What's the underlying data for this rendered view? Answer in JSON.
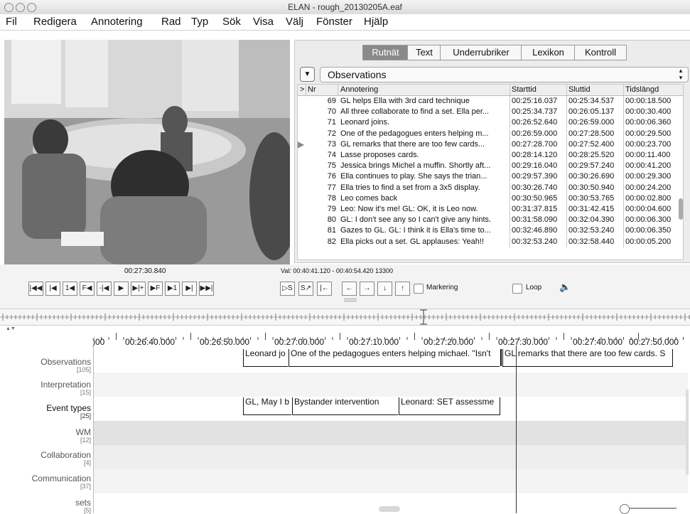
{
  "window": {
    "title": "ELAN - rough_20130205A.eaf"
  },
  "menu": [
    "Fil",
    "Redigera",
    "Annotering",
    "Rad",
    "Typ",
    "Sök",
    "Visa",
    "Välj",
    "Fönster",
    "Hjälp"
  ],
  "tabs": [
    {
      "label": "Rutnät",
      "selected": true
    },
    {
      "label": "Text",
      "selected": false
    },
    {
      "label": "Underrubriker",
      "selected": false
    },
    {
      "label": "Lexikon",
      "selected": false
    },
    {
      "label": "Kontroll",
      "selected": false
    }
  ],
  "grid": {
    "tier": "Observations",
    "dropdown_symbol": "▼",
    "spinner_symbol": "⌃⌄",
    "columns": {
      "marker": ">",
      "nr": "Nr",
      "annotation": "Annotering",
      "start": "Starttid",
      "end": "Sluttid",
      "duration": "Tidslängd"
    },
    "current_marker": "▶",
    "rows": [
      {
        "nr": "69",
        "text": "GL helps Ella with 3rd card technique",
        "start": "00:25:16.037",
        "end": "00:25:34.537",
        "dur": "00:00:18.500",
        "current": false
      },
      {
        "nr": "70",
        "text": "All three collaborate to find a set. Ella per...",
        "start": "00:25:34.737",
        "end": "00:26:05.137",
        "dur": "00:00:30.400",
        "current": false
      },
      {
        "nr": "71",
        "text": "Leonard joins.",
        "start": "00:26:52.640",
        "end": "00:26:59.000",
        "dur": "00:00:06.360",
        "current": false
      },
      {
        "nr": "72",
        "text": "One of the pedagogues enters helping m...",
        "start": "00:26:59.000",
        "end": "00:27:28.500",
        "dur": "00:00:29.500",
        "current": false
      },
      {
        "nr": "73",
        "text": "GL remarks that there are too few cards...",
        "start": "00:27:28.700",
        "end": "00:27:52.400",
        "dur": "00:00:23.700",
        "current": true
      },
      {
        "nr": "74",
        "text": "Lasse proposes cards.",
        "start": "00:28:14.120",
        "end": "00:28:25.520",
        "dur": "00:00:11.400",
        "current": false
      },
      {
        "nr": "75",
        "text": "Jessica brings Michel a muffin. Shortly aft...",
        "start": "00:29:16.040",
        "end": "00:29:57.240",
        "dur": "00:00:41.200",
        "current": false
      },
      {
        "nr": "76",
        "text": "Ella continues to play. She says the trian...",
        "start": "00:29:57.390",
        "end": "00:30:26.690",
        "dur": "00:00:29.300",
        "current": false
      },
      {
        "nr": "77",
        "text": "Ella tries to find a set from a 3x5 display.",
        "start": "00:30:26.740",
        "end": "00:30:50.940",
        "dur": "00:00:24.200",
        "current": false
      },
      {
        "nr": "78",
        "text": "Leo comes back",
        "start": "00:30:50.965",
        "end": "00:30:53.765",
        "dur": "00:00:02.800",
        "current": false
      },
      {
        "nr": "79",
        "text": "Leo: Now it's me! GL: OK, it is Leo now.",
        "start": "00:31:37.815",
        "end": "00:31:42.415",
        "dur": "00:00:04.600",
        "current": false
      },
      {
        "nr": "80",
        "text": "GL: I don't see any so I can't give any hints.",
        "start": "00:31:58.090",
        "end": "00:32:04.390",
        "dur": "00:00:06.300",
        "current": false
      },
      {
        "nr": "81",
        "text": "Gazes to GL. GL: I think it is Ella's time to...",
        "start": "00:32:46.890",
        "end": "00:32:53.240",
        "dur": "00:00:06.350",
        "current": false
      },
      {
        "nr": "82",
        "text": "Ella picks out a set. GL applauses: Yeah!!",
        "start": "00:32:53.240",
        "end": "00:32:58.440",
        "dur": "00:00:05.200",
        "current": false
      }
    ]
  },
  "player": {
    "current_time": "00:27:30.840",
    "selection": "Val: 00:40:41.120 - 00:40:54.420  13300",
    "buttons": [
      "|◀◀",
      "|◀",
      "1◀",
      "F◀",
      "-|◀",
      "▶",
      "▶|+",
      "▶F",
      "▶1",
      "▶|",
      "▶▶|"
    ],
    "sel_buttons": [
      "▷S",
      "S↗",
      "|←"
    ],
    "arrow_buttons": [
      "←",
      "→",
      "↓",
      "↑"
    ],
    "marker_label": "Markering",
    "loop_label": "Loop",
    "volume_symbol": "🔈"
  },
  "timeline": {
    "corner": "▲▼",
    "ticks": [
      ")00",
      "00:26:40.000",
      "00:26:50.000",
      "00:27:00.000",
      "00:27:10.000",
      "00:27:20.000",
      "00:27:30.000",
      "00:27:40.000",
      "00:27:50.000"
    ],
    "tiers": [
      {
        "name": "Observations",
        "count": "[105]",
        "active": false
      },
      {
        "name": "Interpretation",
        "count": "[15]",
        "active": false
      },
      {
        "name": "Event types",
        "count": "[25]",
        "active": true
      },
      {
        "name": "WM",
        "count": "[12]",
        "active": false
      },
      {
        "name": "Collaboration",
        "count": "[4]",
        "active": false
      },
      {
        "name": "Communication",
        "count": "[37]",
        "active": false
      },
      {
        "name": "sets",
        "count": "[5]",
        "active": false
      }
    ],
    "obs_annotations": [
      "Leonard jo",
      "One of the pedagogues enters helping michael. \"Isn't",
      "GL remarks that there are too few cards. S"
    ],
    "event_annotations": [
      "GL, May I b",
      "Bystander intervention",
      "Leonard: SET assessme"
    ]
  }
}
